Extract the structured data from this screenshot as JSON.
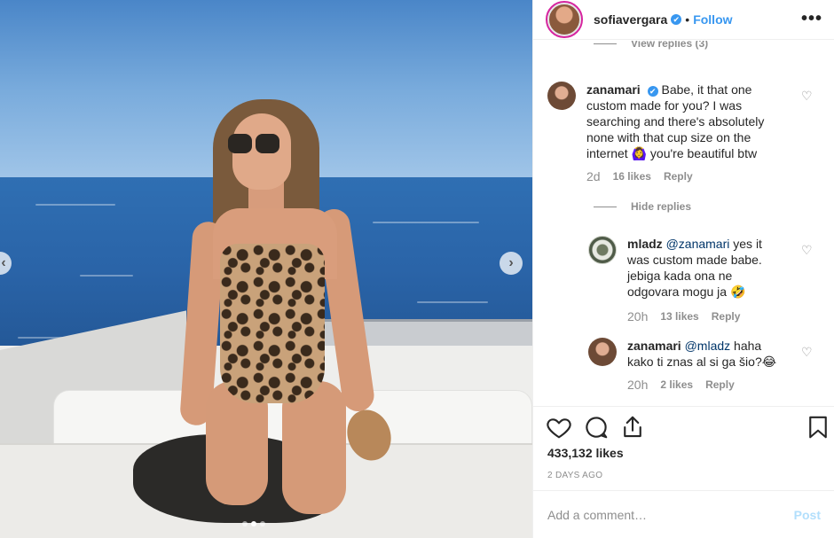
{
  "post": {
    "carousel": {
      "total_slides": 3,
      "active_slide": 2
    }
  },
  "header": {
    "username": "sofiavergara",
    "verified_mark": "✔",
    "separator": "•",
    "follow_label": "Follow",
    "more_label": "•••"
  },
  "comments": {
    "view_replies_top": "View replies (3)",
    "main": {
      "user": "zanamari",
      "verified_mark": "✔",
      "text": "Babe, it that one custom made for you? I was searching and there's absolutely none with that cup size on the internet 🙆‍♀️ you're beautiful btw",
      "time": "2d",
      "likes": "16 likes",
      "reply": "Reply"
    },
    "hide_replies": "Hide replies",
    "replies": [
      {
        "user": "mladz",
        "mention": "@zanamari",
        "text": "yes it was custom made babe. jebiga kada ona ne odgovara mogu ja 🤣",
        "time": "20h",
        "likes": "13 likes",
        "reply": "Reply"
      },
      {
        "user": "zanamari",
        "mention": "@mladz",
        "text": "haha kako ti znas al si ga šio?😂",
        "time": "20h",
        "likes": "2 likes",
        "reply": "Reply"
      }
    ],
    "heart_icon": "♡"
  },
  "actions": {
    "likes": "433,132 likes",
    "date": "2 DAYS AGO"
  },
  "add_comment": {
    "placeholder": "Add a comment…",
    "post_label": "Post"
  },
  "colors": {
    "accent": "#3897f0",
    "post_disabled": "#b2dffc",
    "muted": "#8e8e8e"
  }
}
